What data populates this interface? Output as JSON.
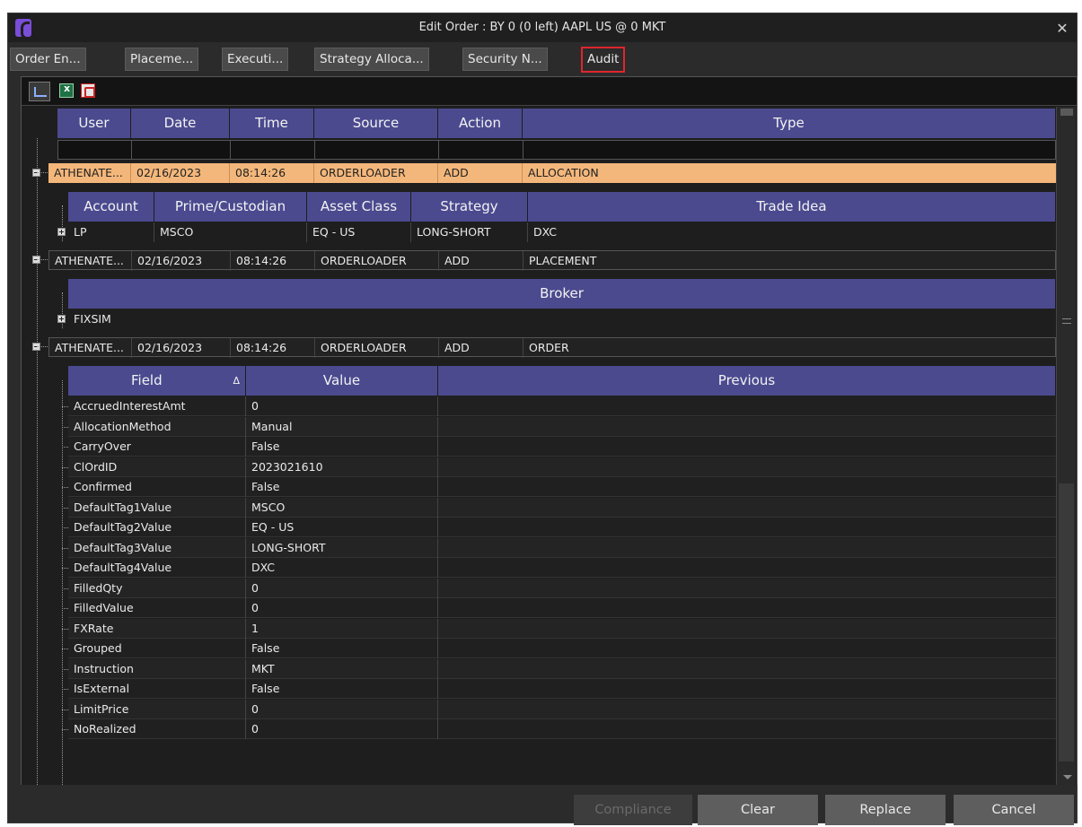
{
  "window": {
    "title": "Edit Order : BY 0 (0 left) AAPL US @ 0 MKT"
  },
  "tabs": [
    {
      "label": "Order En..."
    },
    {
      "label": "Placeme..."
    },
    {
      "label": "Executi..."
    },
    {
      "label": "Strategy Alloca..."
    },
    {
      "label": "Security N..."
    },
    {
      "label": "Audit",
      "active": true
    }
  ],
  "toolbar": {
    "icons": [
      "chart-icon",
      "excel-export-icon",
      "pdf-export-icon"
    ]
  },
  "audit": {
    "columns": [
      "User",
      "Date",
      "Time",
      "Source",
      "Action",
      "Type"
    ],
    "records": [
      {
        "user": "ATHENATE...",
        "date": "02/16/2023",
        "time": "08:14:26",
        "source": "ORDERLOADER",
        "action": "ADD",
        "type": "ALLOCATION",
        "selected": true,
        "child_columns": [
          "Account",
          "Prime/Custodian",
          "Asset Class",
          "Strategy",
          "Trade Idea"
        ],
        "child_rows": [
          {
            "account": "LP",
            "prime": "MSCO",
            "asset_class": "EQ - US",
            "strategy": "LONG-SHORT",
            "trade_idea": "DXC"
          }
        ]
      },
      {
        "user": "ATHENATE...",
        "date": "02/16/2023",
        "time": "08:14:26",
        "source": "ORDERLOADER",
        "action": "ADD",
        "type": "PLACEMENT",
        "child_columns": [
          "Broker"
        ],
        "child_rows": [
          {
            "broker": "FIXSIM"
          }
        ]
      },
      {
        "user": "ATHENATE...",
        "date": "02/16/2023",
        "time": "08:14:26",
        "source": "ORDERLOADER",
        "action": "ADD",
        "type": "ORDER",
        "child_columns": [
          "Field",
          "Value",
          "Previous"
        ],
        "sort_indicator": "Δ",
        "child_rows": [
          {
            "field": "AccruedInterestAmt",
            "value": "0",
            "previous": ""
          },
          {
            "field": "AllocationMethod",
            "value": "Manual",
            "previous": ""
          },
          {
            "field": "CarryOver",
            "value": "False",
            "previous": ""
          },
          {
            "field": "ClOrdID",
            "value": "2023021610",
            "previous": ""
          },
          {
            "field": "Confirmed",
            "value": "False",
            "previous": ""
          },
          {
            "field": "DefaultTag1Value",
            "value": "MSCO",
            "previous": ""
          },
          {
            "field": "DefaultTag2Value",
            "value": "EQ - US",
            "previous": ""
          },
          {
            "field": "DefaultTag3Value",
            "value": "LONG-SHORT",
            "previous": ""
          },
          {
            "field": "DefaultTag4Value",
            "value": "DXC",
            "previous": ""
          },
          {
            "field": "FilledQty",
            "value": "0",
            "previous": ""
          },
          {
            "field": "FilledValue",
            "value": "0",
            "previous": ""
          },
          {
            "field": "FXRate",
            "value": "1",
            "previous": ""
          },
          {
            "field": "Grouped",
            "value": "False",
            "previous": ""
          },
          {
            "field": "Instruction",
            "value": "MKT",
            "previous": ""
          },
          {
            "field": "IsExternal",
            "value": "False",
            "previous": ""
          },
          {
            "field": "LimitPrice",
            "value": "0",
            "previous": ""
          },
          {
            "field": "NoRealized",
            "value": "0",
            "previous": ""
          }
        ]
      }
    ]
  },
  "buttons": {
    "compliance": "Compliance",
    "clear": "Clear",
    "replace": "Replace",
    "cancel": "Cancel"
  },
  "colors": {
    "header_bg": "#4b4a8f",
    "selected_row": "#f4b77b",
    "active_tab_outline": "#e0252d",
    "window_bg": "#2b2b2b"
  }
}
